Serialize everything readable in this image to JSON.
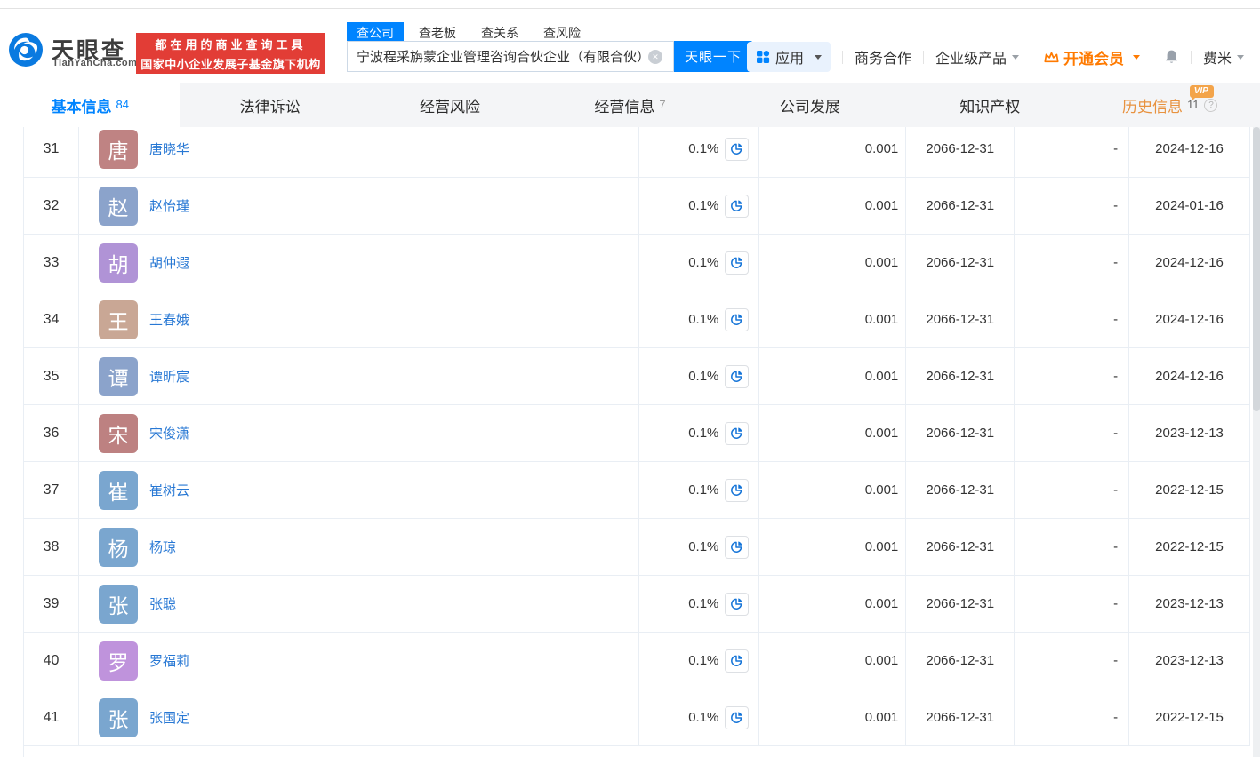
{
  "brand": {
    "name": "天眼查",
    "domain": "TianYanCha.com",
    "slogan1": "都在用的商业查询工具",
    "slogan2": "国家中小企业发展子基金旗下机构"
  },
  "search": {
    "tabs": [
      {
        "key": "company",
        "label": "查公司",
        "active": true
      },
      {
        "key": "boss",
        "label": "查老板",
        "active": false
      },
      {
        "key": "relation",
        "label": "查关系",
        "active": false
      },
      {
        "key": "risk",
        "label": "查风险",
        "active": false
      }
    ],
    "value": "宁波程采旃蒙企业管理咨询合伙企业（有限合伙）",
    "button_label": "天眼一下"
  },
  "nav": {
    "apps_label": "应用",
    "business_label": "商务合作",
    "enterprise_label": "企业级产品",
    "vip_label": "开通会员",
    "username": "费米"
  },
  "page_tabs": [
    {
      "key": "basic-info",
      "label": "基本信息",
      "count": "84",
      "count_style": "blue",
      "active": true
    },
    {
      "key": "legal",
      "label": "法律诉讼"
    },
    {
      "key": "operation-risk",
      "label": "经营风险"
    },
    {
      "key": "business-info",
      "label": "经营信息",
      "count": "7",
      "count_style": "gray"
    },
    {
      "key": "development",
      "label": "公司发展"
    },
    {
      "key": "ip",
      "label": "知识产权"
    },
    {
      "key": "history",
      "label": "历史信息",
      "count": "11",
      "count_style": "dark",
      "vip_badge": "VIP",
      "has_help": true,
      "history": true
    }
  ],
  "table": {
    "rows": [
      {
        "no": "31",
        "char": "唐",
        "color": "#bf8383",
        "name": "唐晓华",
        "percent": "0.1%",
        "amount": "0.001",
        "until": "2066-12-31",
        "dash": "-",
        "date": "2024-12-16"
      },
      {
        "no": "32",
        "char": "赵",
        "color": "#8ba3cb",
        "name": "赵怡瑾",
        "percent": "0.1%",
        "amount": "0.001",
        "until": "2066-12-31",
        "dash": "-",
        "date": "2024-01-16"
      },
      {
        "no": "33",
        "char": "胡",
        "color": "#b093d6",
        "name": "胡仲遐",
        "percent": "0.1%",
        "amount": "0.001",
        "until": "2066-12-31",
        "dash": "-",
        "date": "2024-12-16"
      },
      {
        "no": "34",
        "char": "王",
        "color": "#c9a795",
        "name": "王春娥",
        "percent": "0.1%",
        "amount": "0.001",
        "until": "2066-12-31",
        "dash": "-",
        "date": "2024-12-16"
      },
      {
        "no": "35",
        "char": "谭",
        "color": "#8ba3cb",
        "name": "谭昕宸",
        "percent": "0.1%",
        "amount": "0.001",
        "until": "2066-12-31",
        "dash": "-",
        "date": "2024-12-16"
      },
      {
        "no": "36",
        "char": "宋",
        "color": "#bd8181",
        "name": "宋俊潇",
        "percent": "0.1%",
        "amount": "0.001",
        "until": "2066-12-31",
        "dash": "-",
        "date": "2023-12-13"
      },
      {
        "no": "37",
        "char": "崔",
        "color": "#7aa6cf",
        "name": "崔树云",
        "percent": "0.1%",
        "amount": "0.001",
        "until": "2066-12-31",
        "dash": "-",
        "date": "2022-12-15"
      },
      {
        "no": "38",
        "char": "杨",
        "color": "#7aa6cf",
        "name": "杨琼",
        "percent": "0.1%",
        "amount": "0.001",
        "until": "2066-12-31",
        "dash": "-",
        "date": "2022-12-15"
      },
      {
        "no": "39",
        "char": "张",
        "color": "#7aa6cf",
        "name": "张聪",
        "percent": "0.1%",
        "amount": "0.001",
        "until": "2066-12-31",
        "dash": "-",
        "date": "2023-12-13"
      },
      {
        "no": "40",
        "char": "罗",
        "color": "#bf93dc",
        "name": "罗福莉",
        "percent": "0.1%",
        "amount": "0.001",
        "until": "2066-12-31",
        "dash": "-",
        "date": "2023-12-13"
      },
      {
        "no": "41",
        "char": "张",
        "color": "#7aa6cf",
        "name": "张国定",
        "percent": "0.1%",
        "amount": "0.001",
        "until": "2066-12-31",
        "dash": "-",
        "date": "2022-12-15"
      }
    ]
  },
  "colors": {
    "primary": "#0084ff",
    "link": "#2878d4",
    "history_orange": "#e8923f",
    "vip_orange": "#ff7a00",
    "banner_red": "#e23d36"
  }
}
